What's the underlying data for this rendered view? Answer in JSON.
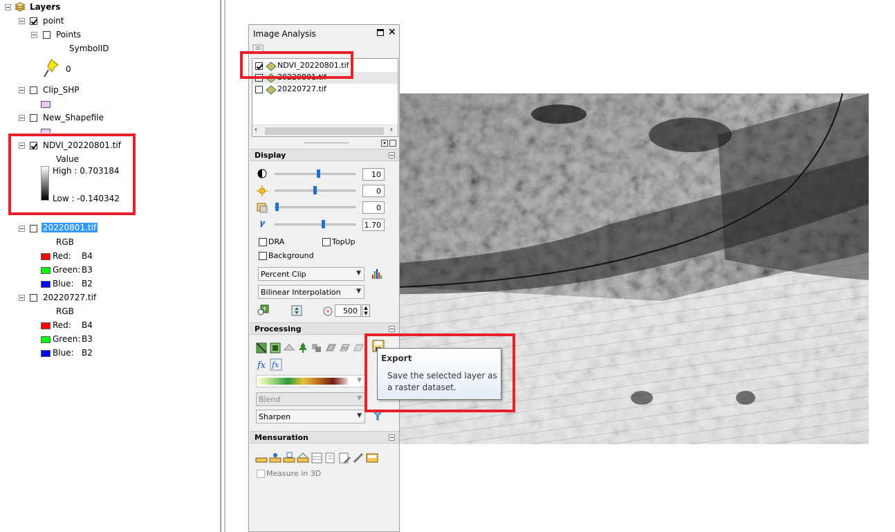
{
  "toc": {
    "root_label": "Layers",
    "layers": [
      {
        "name": "point",
        "checked": true,
        "sublayer": "Points",
        "field": "SymbolID",
        "value": "0"
      },
      {
        "name": "Clip_SHP",
        "checked": false
      },
      {
        "name": "New_Shapefile",
        "checked": false
      },
      {
        "name": "NDVI_20220801.tif",
        "checked": true,
        "value_label": "Value",
        "high": "High : 0.703184",
        "low": "Low : -0.140342"
      },
      {
        "name": "20220801.tif",
        "checked": false,
        "selected": true,
        "render": "RGB",
        "bands": [
          {
            "label": "Red:",
            "band": "B4"
          },
          {
            "label": "Green:",
            "band": "B3"
          },
          {
            "label": "Blue:",
            "band": "B2"
          }
        ]
      },
      {
        "name": "20220727.tif",
        "checked": false,
        "render": "RGB",
        "bands": [
          {
            "label": "Red:",
            "band": "B4"
          },
          {
            "label": "Green:",
            "band": "B3"
          },
          {
            "label": "Blue:",
            "band": "B2"
          }
        ]
      }
    ]
  },
  "image_analysis": {
    "title": "Image Analysis",
    "layer_list": [
      {
        "name": "NDVI_20220801.tif",
        "checked": true
      },
      {
        "name": "20220801.tif",
        "checked": false
      },
      {
        "name": "20220727.tif",
        "checked": false
      }
    ],
    "display": {
      "header": "Display",
      "contrast": "10",
      "brightness": "0",
      "transparency": "0",
      "gamma": "1.70",
      "dra_label": "DRA",
      "topup_label": "TopUp",
      "background_label": "Background",
      "stretch": "Percent Clip",
      "resampling": "Bilinear Interpolation",
      "zoom": "500"
    },
    "processing": {
      "header": "Processing",
      "blend": "Blend",
      "sharpen": "Sharpen"
    },
    "mensuration": {
      "header": "Mensuration",
      "measure3d_label": "Measure in 3D"
    }
  },
  "tooltip": {
    "title": "Export",
    "text_line1": "Save the selected layer as",
    "text_line2": "a raster dataset."
  },
  "colors": {
    "highlight_red": "#e8202a",
    "selection_blue": "#3399ff",
    "slider_blue": "#1f72d2"
  }
}
